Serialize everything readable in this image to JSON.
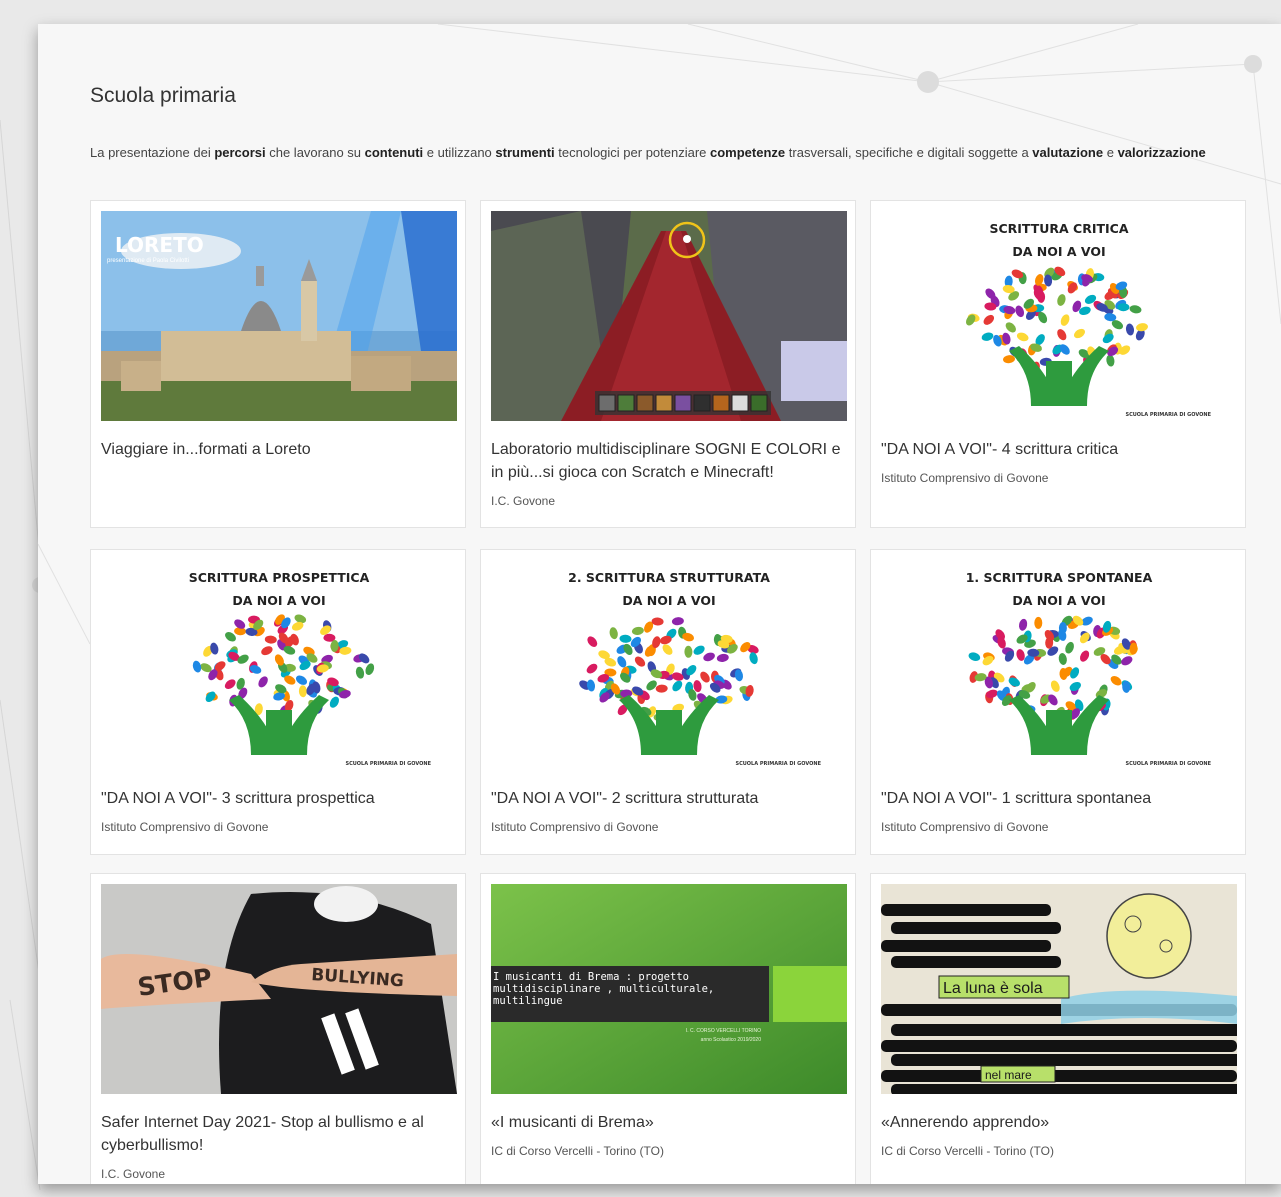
{
  "section": {
    "title": "Scuola primaria",
    "description_parts": [
      {
        "text": "La presentazione dei ",
        "bold": false
      },
      {
        "text": "percorsi",
        "bold": true
      },
      {
        "text": " che lavorano su ",
        "bold": false
      },
      {
        "text": "contenuti",
        "bold": true
      },
      {
        "text": " e utilizzano ",
        "bold": false
      },
      {
        "text": "strumenti",
        "bold": true
      },
      {
        "text": " tecnologici per potenziare ",
        "bold": false
      },
      {
        "text": "competenze",
        "bold": true
      },
      {
        "text": " trasversali, specifiche e digitali soggette a ",
        "bold": false
      },
      {
        "text": "valutazione",
        "bold": true
      },
      {
        "text": " e ",
        "bold": false
      },
      {
        "text": "valorizzazione",
        "bold": true
      }
    ]
  },
  "cards": [
    {
      "title": "Viaggiare in...formati a Loreto",
      "author": "",
      "thumb": {
        "kind": "loreto",
        "title": "LORETO",
        "subtitle": "presentazione di Paola Civilotti"
      }
    },
    {
      "title": "Laboratorio multidisciplinare SOGNI E COLORI e in più...si gioca con Scratch e Minecraft!",
      "author": "I.C. Govone",
      "thumb": {
        "kind": "minecraft"
      }
    },
    {
      "title": "\"DA NOI A VOI\"- 4 scrittura critica",
      "author": "Istituto Comprensivo di Govone",
      "thumb": {
        "kind": "tree",
        "line1": "SCRITTURA CRITICA",
        "line2": "DA NOI A VOI",
        "footer": "SCUOLA PRIMARIA DI GOVONE"
      }
    },
    {
      "title": "\"DA NOI A VOI\"- 3 scrittura prospettica",
      "author": "Istituto Comprensivo di Govone",
      "thumb": {
        "kind": "tree",
        "line1": "SCRITTURA PROSPETTICA",
        "line2": "DA NOI A VOI",
        "footer": "SCUOLA PRIMARIA DI GOVONE"
      }
    },
    {
      "title": "\"DA NOI A VOI\"- 2 scrittura strutturata",
      "author": "Istituto Comprensivo di Govone",
      "thumb": {
        "kind": "tree",
        "line1": "2. SCRITTURA STRUTTURATA",
        "line2": "DA NOI A VOI",
        "footer": "SCUOLA PRIMARIA DI GOVONE"
      }
    },
    {
      "title": "\"DA NOI A VOI\"- 1 scrittura spontanea",
      "author": "Istituto Comprensivo di Govone",
      "thumb": {
        "kind": "tree",
        "line1": "1. SCRITTURA SPONTANEA",
        "line2": "DA NOI A VOI",
        "footer": "SCUOLA PRIMARIA DI GOVONE"
      }
    },
    {
      "title": "Safer Internet Day 2021- Stop al bullismo e al cyberbullismo!",
      "author": "I.C. Govone",
      "thumb": {
        "kind": "bullying",
        "word1": "STOP",
        "word2": "BULLYING"
      }
    },
    {
      "title": "«I musicanti di Brema»",
      "author": "IC di Corso Vercelli - Torino (TO)",
      "thumb": {
        "kind": "brema",
        "text": "I musicanti di Brema : progetto multidisciplinare , multiculturale, multilingue",
        "small1": "I. C. CORSO VERCELLI TORINO",
        "small2": "anno Scolastico 2019/2020"
      }
    },
    {
      "title": "«Annerendo apprendo»",
      "author": "IC di Corso Vercelli - Torino (TO)",
      "thumb": {
        "kind": "luna",
        "word1": "La luna è sola",
        "word2": "nel mare"
      }
    }
  ],
  "colors": {
    "page_bg": "#e9e9e9",
    "panel_bg": "#f7f7f7",
    "card_bg": "#ffffff",
    "title": "#333333"
  }
}
